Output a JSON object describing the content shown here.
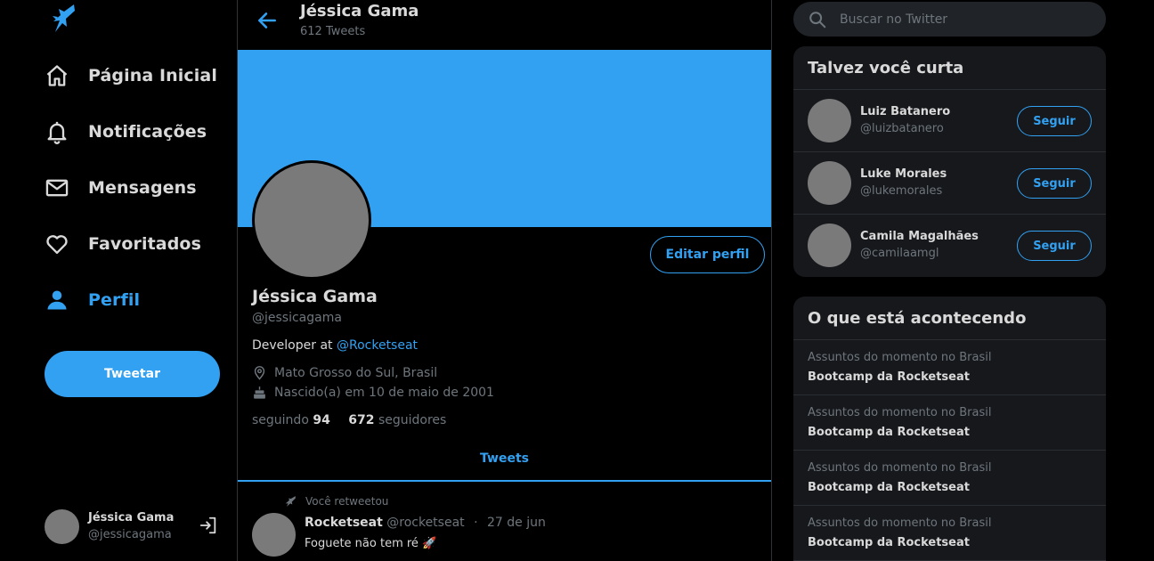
{
  "colors": {
    "accent": "#32a1f2",
    "background": "#000000",
    "card": "#16181c",
    "avatar_placeholder": "#7a7a7a"
  },
  "sidebar": {
    "logo_icon": "rocket-bird-icon",
    "items": [
      {
        "icon": "home-icon",
        "label": "Página Inicial"
      },
      {
        "icon": "bell-icon",
        "label": "Notificações"
      },
      {
        "icon": "mail-icon",
        "label": "Mensagens"
      },
      {
        "icon": "heart-icon",
        "label": "Favoritados"
      },
      {
        "icon": "user-icon",
        "label": "Perfil",
        "active": true
      }
    ],
    "tweet_button": "Tweetar",
    "account": {
      "name": "Jéssica Gama",
      "handle": "@jessicagama",
      "logout_icon": "logout-icon"
    }
  },
  "header": {
    "title": "Jéssica Gama",
    "subtitle": "612 Tweets"
  },
  "profile": {
    "edit_button": "Editar perfil",
    "name": "Jéssica Gama",
    "handle": "@jessicagama",
    "bio_prefix": "Developer at ",
    "bio_link": "@Rocketseat",
    "location": "Mato Grosso do Sul, Brasil",
    "birthday": "Nascido(a) em 10 de maio de 2001",
    "following_label": "seguindo",
    "following_count": "94",
    "followers_count": "672",
    "followers_label": "seguidores"
  },
  "tabs": {
    "tweets": "Tweets"
  },
  "tweet": {
    "retweet_label": "Você retweetou",
    "author": "Rocketseat",
    "handle": "@rocketseat",
    "separator": "·",
    "date": "27 de jun",
    "text": "Foguete não tem ré 🚀"
  },
  "search": {
    "placeholder": "Buscar no Twitter"
  },
  "who_to_follow": {
    "title": "Talvez você curta",
    "button": "Seguir",
    "users": [
      {
        "name": "Luiz Batanero",
        "handle": "@luizbatanero"
      },
      {
        "name": "Luke Morales",
        "handle": "@lukemorales"
      },
      {
        "name": "Camila Magalhães",
        "handle": "@camilaamgl"
      }
    ]
  },
  "trends": {
    "title": "O que está acontecendo",
    "items": [
      {
        "context": "Assuntos do momento no Brasil",
        "topic": "Bootcamp da Rocketseat"
      },
      {
        "context": "Assuntos do momento no Brasil",
        "topic": "Bootcamp da Rocketseat"
      },
      {
        "context": "Assuntos do momento no Brasil",
        "topic": "Bootcamp da Rocketseat"
      },
      {
        "context": "Assuntos do momento no Brasil",
        "topic": "Bootcamp da Rocketseat"
      }
    ]
  }
}
